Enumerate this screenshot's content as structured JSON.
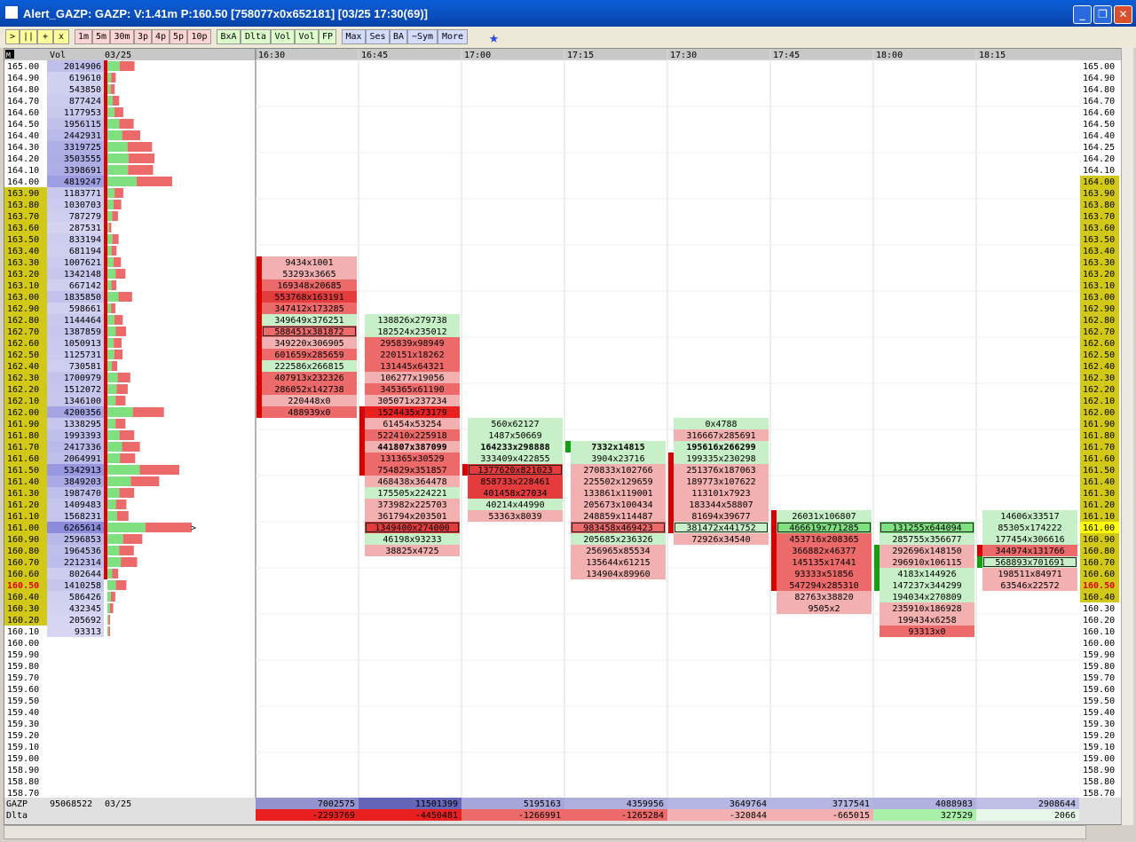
{
  "window": {
    "title": "Alert_GAZP: GAZP: V:1.41m P:160.50 [758077x0x652181] [03/25 17:30(69)]",
    "buttons": [
      "_",
      "❐",
      "✕"
    ]
  },
  "toolbar": {
    "groups": [
      {
        "cls": "g1",
        "items": [
          ">",
          "||",
          "+",
          "x"
        ]
      },
      {
        "cls": "g2",
        "items": [
          "1m",
          "5m",
          "30m",
          "3p",
          "4p",
          "5p",
          "10p"
        ]
      },
      {
        "cls": "g3",
        "items": [
          "BxA",
          "Dlta",
          "Vol",
          "Vol",
          "FP"
        ]
      },
      {
        "cls": "g4",
        "items": [
          "Max",
          "Ses",
          "BA",
          "~Sym",
          "More"
        ]
      }
    ]
  },
  "header": {
    "corner": "M",
    "vol": "Vol",
    "date": "03/25",
    "times": [
      "16:30",
      "16:45",
      "17:00",
      "17:15",
      "17:30",
      "17:45",
      "18:00",
      "18:15"
    ]
  },
  "prices": [
    "165.00",
    "164.90",
    "164.80",
    "164.70",
    "164.60",
    "164.50",
    "164.40",
    "164.30",
    "164.20",
    "164.10",
    "164.00",
    "163.90",
    "163.80",
    "163.70",
    "163.60",
    "163.50",
    "163.40",
    "163.30",
    "163.20",
    "163.10",
    "163.00",
    "162.90",
    "162.80",
    "162.70",
    "162.60",
    "162.50",
    "162.40",
    "162.30",
    "162.20",
    "162.10",
    "162.00",
    "161.90",
    "161.80",
    "161.70",
    "161.60",
    "161.50",
    "161.40",
    "161.30",
    "161.20",
    "161.10",
    "161.00",
    "160.90",
    "160.80",
    "160.70",
    "160.60",
    "160.50",
    "160.40",
    "160.30",
    "160.20",
    "160.10",
    "160.00",
    "159.90",
    "159.80",
    "159.70",
    "159.60",
    "159.50",
    "159.40",
    "159.30",
    "159.20",
    "159.10",
    "159.00",
    "158.90",
    "158.80",
    "158.70"
  ],
  "right_prices": [
    "165.00",
    "164.90",
    "164.80",
    "164.70",
    "164.60",
    "164.50",
    "164.40",
    "164.25",
    "164.20",
    "164.10",
    "164.00",
    "163.90",
    "163.80",
    "163.70",
    "163.60",
    "163.50",
    "163.40",
    "163.30",
    "163.20",
    "163.10",
    "163.00",
    "162.90",
    "162.80",
    "162.70",
    "162.60",
    "162.50",
    "162.40",
    "162.30",
    "162.20",
    "162.10",
    "162.00",
    "161.90",
    "161.80",
    "161.70",
    "161.60",
    "161.50",
    "161.40",
    "161.30",
    "161.20",
    "161.10",
    "161.00",
    "160.90",
    "160.80",
    "160.70",
    "160.60",
    "160.50",
    "160.40",
    "160.30",
    "160.20",
    "160.10",
    "160.00",
    "159.90",
    "159.80",
    "159.70",
    "159.60",
    "159.50",
    "159.40",
    "159.30",
    "159.20",
    "159.10",
    "159.00",
    "158.90",
    "158.80",
    "158.70"
  ],
  "volumes": [
    "2014906",
    "619610",
    "543850",
    "877424",
    "1177953",
    "1956115",
    "2442931",
    "3319725",
    "3503555",
    "3398691",
    "4819247",
    "1183771",
    "1030703",
    "787279",
    "287531",
    "833194",
    "681194",
    "1007621",
    "1342148",
    "667142",
    "1835850",
    "598661",
    "1144464",
    "1387859",
    "1050913",
    "1125731",
    "730581",
    "1700979",
    "1512072",
    "1346100",
    "4200356",
    "1338295",
    "1993393",
    "2417336",
    "2064991",
    "5342913",
    "3849203",
    "1987470",
    "1409483",
    "1568231",
    "6265614",
    "2596853",
    "1964536",
    "2212314",
    "802644",
    "1410258",
    "586426",
    "432345",
    "205692",
    "93313"
  ],
  "current_price": "160.50",
  "profile_marker": ">",
  "columns": [
    {
      "time": "16:30",
      "start": 17,
      "cells": [
        [
          "9434x1001",
          "lr",
          ""
        ],
        [
          "53293x3665",
          "lr",
          ""
        ],
        [
          "169348x20685",
          "mr",
          ""
        ],
        [
          "553768x163191",
          "dr",
          ""
        ],
        [
          "347412x173285",
          "mr",
          ""
        ],
        [
          "349649x376251",
          "lg",
          ""
        ],
        [
          "588451x381872",
          "mr",
          "box"
        ],
        [
          "349220x306905",
          "lr",
          ""
        ],
        [
          "601659x285659",
          "mr",
          ""
        ],
        [
          "222586x266815",
          "lg",
          ""
        ],
        [
          "407913x232326",
          "mr",
          ""
        ],
        [
          "286052x142738",
          "mr",
          ""
        ],
        [
          "220448x0",
          "lr",
          ""
        ],
        [
          "488939x0",
          "mr",
          ""
        ]
      ],
      "marks": [
        1,
        1,
        1,
        1,
        1,
        1,
        1,
        1,
        1,
        1,
        1,
        1,
        1,
        1
      ]
    },
    {
      "time": "16:45",
      "start": 22,
      "cells": [
        [
          "138826x279738",
          "lg",
          ""
        ],
        [
          "182524x235012",
          "lg",
          ""
        ],
        [
          "295839x98949",
          "mr",
          ""
        ],
        [
          "220151x18262",
          "mr",
          ""
        ],
        [
          "131445x64321",
          "mr",
          ""
        ],
        [
          "106277x19056",
          "lr",
          ""
        ],
        [
          "345365x61190",
          "mr",
          ""
        ],
        [
          "305071x237234",
          "lr",
          ""
        ],
        [
          "1524435x73179",
          "br",
          ""
        ],
        [
          "61454x53254",
          "lr",
          ""
        ],
        [
          "522410x225918",
          "mr",
          ""
        ],
        [
          "441807x387099",
          "lr",
          "bold"
        ],
        [
          "131365x30529",
          "mr",
          ""
        ],
        [
          "754829x351857",
          "mr",
          ""
        ],
        [
          "468438x364478",
          "lr",
          ""
        ],
        [
          "175505x224221",
          "lg",
          ""
        ],
        [
          "373982x225703",
          "lr",
          ""
        ],
        [
          "361794x203501",
          "lr",
          ""
        ],
        [
          "1349400x274000",
          "dr",
          "box"
        ],
        [
          "46198x93233",
          "lg",
          ""
        ],
        [
          "38825x4725",
          "lr",
          ""
        ]
      ],
      "marks": [
        0,
        0,
        0,
        0,
        0,
        0,
        0,
        0,
        1,
        1,
        1,
        1,
        1,
        1,
        0,
        0,
        0,
        0,
        0,
        0,
        0
      ]
    },
    {
      "time": "17:00",
      "start": 31,
      "cells": [
        [
          "560x62127",
          "lg",
          ""
        ],
        [
          "1487x50669",
          "lg",
          ""
        ],
        [
          "164233x298888",
          "lg",
          "bold"
        ],
        [
          "333409x422855",
          "lg",
          ""
        ],
        [
          "1377620x821023",
          "dr",
          "box"
        ],
        [
          "858733x228461",
          "dr",
          ""
        ],
        [
          "401458x27034",
          "dr",
          ""
        ],
        [
          "40214x44990",
          "lg",
          ""
        ],
        [
          "53363x8039",
          "lr",
          ""
        ]
      ],
      "marks": [
        0,
        0,
        0,
        0,
        1,
        0,
        0,
        0,
        0
      ]
    },
    {
      "time": "17:15",
      "start": 33,
      "cells": [
        [
          "7332x14815",
          "lg",
          "bold"
        ],
        [
          "3904x23716",
          "lg",
          ""
        ],
        [
          "270833x102766",
          "lr",
          ""
        ],
        [
          "225502x129659",
          "lr",
          ""
        ],
        [
          "133861x119001",
          "lr",
          ""
        ],
        [
          "205673x100434",
          "lr",
          ""
        ],
        [
          "248859x114487",
          "lr",
          ""
        ],
        [
          "983458x469423",
          "mr",
          "box"
        ],
        [
          "205685x236326",
          "lg",
          ""
        ],
        [
          "256965x85534",
          "lr",
          ""
        ],
        [
          "135644x61215",
          "lr",
          ""
        ],
        [
          "134904x89960",
          "lr",
          ""
        ]
      ],
      "marks": [
        2,
        0,
        0,
        0,
        0,
        0,
        0,
        0,
        0,
        0,
        0,
        0
      ]
    },
    {
      "time": "17:30",
      "start": 31,
      "cells": [
        [
          "0x4788",
          "lg",
          ""
        ],
        [
          "316667x285691",
          "lr",
          ""
        ],
        [
          "195616x266299",
          "lg",
          "bold"
        ],
        [
          "199335x230298",
          "lg",
          ""
        ],
        [
          "251376x187063",
          "lr",
          ""
        ],
        [
          "189773x107622",
          "lr",
          ""
        ],
        [
          "113101x7923",
          "lr",
          ""
        ],
        [
          "183344x58807",
          "lr",
          ""
        ],
        [
          "81694x39677",
          "lr",
          ""
        ],
        [
          "381472x441752",
          "lg",
          "box"
        ],
        [
          "72926x34540",
          "lr",
          ""
        ]
      ],
      "marks": [
        0,
        0,
        0,
        1,
        1,
        1,
        1,
        1,
        1,
        1,
        0
      ]
    },
    {
      "time": "17:45",
      "start": 39,
      "cells": [
        [
          "26031x106807",
          "lg",
          ""
        ],
        [
          "466619x771285",
          "mg",
          "box"
        ],
        [
          "453716x208365",
          "mr",
          ""
        ],
        [
          "366882x46377",
          "mr",
          ""
        ],
        [
          "145135x17441",
          "mr",
          ""
        ],
        [
          "93333x51856",
          "mr",
          ""
        ],
        [
          "547294x285310",
          "mr",
          ""
        ],
        [
          "82763x38820",
          "lr",
          ""
        ],
        [
          "9505x2",
          "lr",
          ""
        ]
      ],
      "marks": [
        1,
        1,
        1,
        1,
        1,
        1,
        1,
        0,
        0
      ]
    },
    {
      "time": "18:00",
      "start": 40,
      "cells": [
        [
          "131255x644094",
          "mg",
          "box"
        ],
        [
          "285755x356677",
          "lg",
          ""
        ],
        [
          "292696x148150",
          "lr",
          ""
        ],
        [
          "296910x106115",
          "lr",
          ""
        ],
        [
          "4183x144926",
          "lg",
          ""
        ],
        [
          "147237x344299",
          "lg",
          ""
        ],
        [
          "194034x270809",
          "lg",
          ""
        ],
        [
          "235910x186928",
          "lr",
          ""
        ],
        [
          "199434x6258",
          "lr",
          ""
        ],
        [
          "93313x0",
          "mr",
          ""
        ]
      ],
      "marks": [
        0,
        0,
        2,
        2,
        2,
        2,
        0,
        0,
        0,
        0
      ]
    },
    {
      "time": "18:15",
      "start": 39,
      "cells": [
        [
          "14606x33517",
          "lg",
          ""
        ],
        [
          "85305x174222",
          "lg",
          ""
        ],
        [
          "177454x306616",
          "lg",
          ""
        ],
        [
          "344974x131766",
          "mr",
          ""
        ],
        [
          "568893x701691",
          "lg",
          "box"
        ],
        [
          "198511x84971",
          "lr",
          ""
        ],
        [
          "63546x22572",
          "lr",
          ""
        ]
      ],
      "marks": [
        0,
        0,
        0,
        1,
        2,
        0,
        0
      ]
    }
  ],
  "footer": {
    "row1": {
      "label": "GAZP",
      "total": "95068522",
      "date": "03/25",
      "values": [
        "7002575",
        "11501399",
        "5195163",
        "4359956",
        "3649764",
        "3717541",
        "4088983",
        "2908644"
      ]
    },
    "row2": {
      "label": "Dlta",
      "values": [
        "-2293769",
        "-4450481",
        "-1266991",
        "-1265284",
        "-320844",
        "-665015",
        "327529",
        "2066"
      ]
    }
  },
  "colors": {
    "dark_red": "#e43c3c",
    "mid_red": "#ec6a6a",
    "light_red": "#f2b0b0",
    "pale_red": "#f7cdcd",
    "light_green": "#c8f0c8",
    "mid_green": "#7ee07e",
    "blue_cell": "#c8c8ee",
    "yellow_cell": "#d2c818"
  }
}
